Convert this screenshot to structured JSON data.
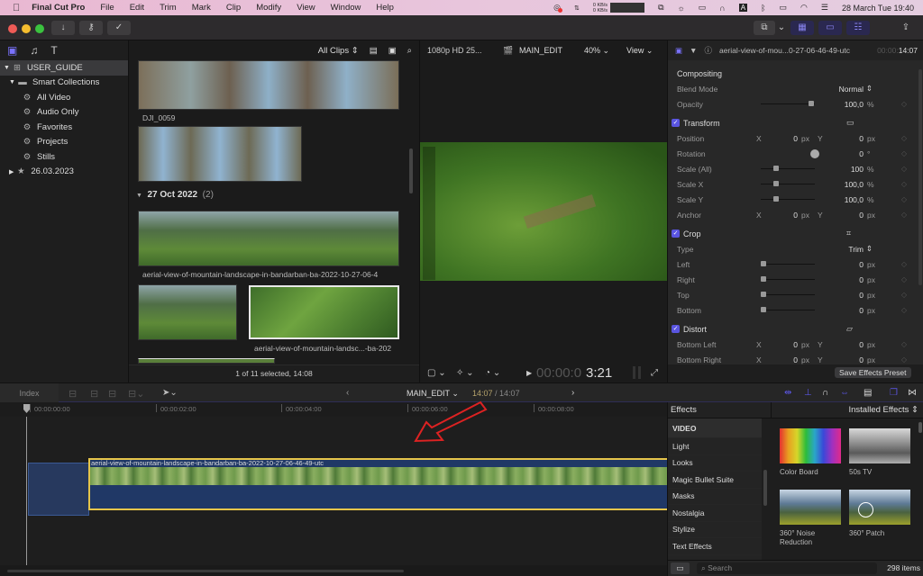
{
  "menubar": {
    "apple_icon": "apple-logo-icon",
    "app_name": "Final Cut Pro",
    "items": [
      "File",
      "Edit",
      "Trim",
      "Mark",
      "Clip",
      "Modify",
      "View",
      "Window",
      "Help"
    ],
    "network_up": "0 KB/s",
    "network_down": "0 KB/s",
    "datetime": "28 March Tue  19:40"
  },
  "toolbar": {
    "import_icon": "download-arrow-icon",
    "keywords_icon": "key-icon",
    "background_tasks_icon": "checkmark-circle-icon",
    "share_icon": "share-icon"
  },
  "sidebar": {
    "library": "USER_GUIDE",
    "smart_collections": "Smart Collections",
    "collections": [
      "All Video",
      "Audio Only",
      "Favorites",
      "Projects",
      "Stills"
    ],
    "event": "26.03.2023"
  },
  "browser": {
    "filter": "All Clips",
    "clips": [
      {
        "name": "DJI_0059"
      },
      {
        "name": ""
      }
    ],
    "group_title": "27 Oct 2022",
    "group_count": "(2)",
    "clip3_name": "aerial-view-of-mountain-landscape-in-bandarban-ba-2022-10-27-06-4",
    "clip4_name": "aerial-view-of-mountain-landsc...-ba-202",
    "status": "1 of 11 selected, 14:08"
  },
  "viewer": {
    "format": "1080p HD 25...",
    "project": "MAIN_EDIT",
    "zoom": "40%",
    "view_menu": "View",
    "timecode_dim": "00:00:0",
    "timecode": "3:21"
  },
  "inspector": {
    "clip_name": "aerial-view-of-mou...0-27-06-46-49-utc",
    "duration_dim": "00:00:",
    "duration": "14:07",
    "compositing": "Compositing",
    "blend_mode_label": "Blend Mode",
    "blend_mode": "Normal",
    "opacity_label": "Opacity",
    "opacity": "100,0",
    "opacity_level_pct": 100,
    "transform": "Transform",
    "position_label": "Position",
    "position_x": "0",
    "position_y": "0",
    "rotation_label": "Rotation",
    "rotation": "0",
    "scale_all_label": "Scale (All)",
    "scale_all": "100",
    "scale_x_label": "Scale X",
    "scale_x": "100,0",
    "scale_y_label": "Scale Y",
    "scale_y": "100,0",
    "anchor_label": "Anchor",
    "anchor_x": "0",
    "anchor_y": "0",
    "crop": "Crop",
    "type_label": "Type",
    "crop_type": "Trim",
    "left_label": "Left",
    "left": "0",
    "right_label": "Right",
    "right": "0",
    "top_label": "Top",
    "top": "0",
    "bottom_label": "Bottom",
    "bottom": "0",
    "distort": "Distort",
    "bl_label": "Bottom Left",
    "bl_x": "0",
    "bl_y": "0",
    "br_label": "Bottom Right",
    "br_x": "0",
    "br_y": "0",
    "px": "px",
    "pct": "%",
    "deg": "°",
    "x": "X",
    "y": "Y",
    "save_preset": "Save Effects Preset"
  },
  "timeline": {
    "index": "Index",
    "project": "MAIN_EDIT",
    "time_current": "14:07",
    "time_total": "/ 14:07",
    "ruler": [
      "00:00:00:00",
      "00:00:02:00",
      "00:00:04:00",
      "00:00:06:00",
      "00:00:08:00"
    ],
    "clip_name": "aerial-view-of-mountain-landscape-in-bandarban-ba-2022-10-27-06-46-49-utc"
  },
  "effects": {
    "title": "Effects",
    "source": "Installed Effects",
    "section": "VIDEO",
    "categories": [
      "Light",
      "Looks",
      "Magic Bullet Suite",
      "Masks",
      "Nostalgia",
      "Stylize",
      "Text Effects"
    ],
    "tiles": [
      "Color Board",
      "50s TV",
      "360° Noise Reduction",
      "360° Patch"
    ],
    "search_placeholder": "Search",
    "count": "298 items"
  }
}
